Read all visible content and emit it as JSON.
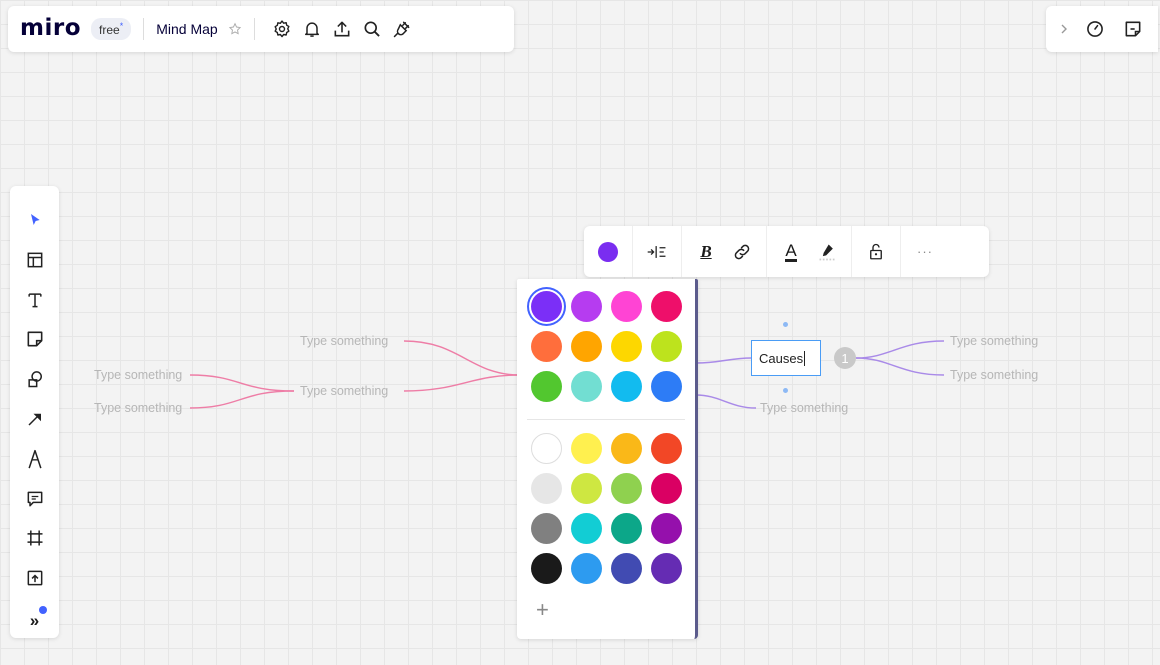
{
  "topbar": {
    "logo": "miro",
    "plan_badge": "free",
    "plan_badge_mark": "*",
    "board_name": "Mind Map",
    "icons": [
      "star-icon",
      "settings-icon",
      "bell-icon",
      "share-icon",
      "search-icon",
      "integrations-icon"
    ]
  },
  "topbar_right": {
    "icons": [
      "chevron-right-icon",
      "timer-icon",
      "sticky-export-icon"
    ]
  },
  "left_toolbar": {
    "tools": [
      "select-tool",
      "templates-tool",
      "text-tool",
      "sticky-note-tool",
      "shapes-tool",
      "connection-line-tool",
      "pen-tool",
      "comment-tool",
      "frame-tool",
      "upload-tool",
      "more-tools"
    ],
    "more_label": "»"
  },
  "mind_map": {
    "selected_node_text": "Causes",
    "collapse_label": "1",
    "nodes": [
      "Type something",
      "Type something",
      "Type something",
      "Type something",
      "Type something",
      "Type something",
      "Type something"
    ],
    "colors": {
      "left_branch": "#ee7da6",
      "right_branch": "#a98ae8",
      "selected_border": "#4a9cf5"
    }
  },
  "context_toolbar": {
    "node_color": "#7a2df0",
    "buttons": [
      "color-button",
      "layout-button",
      "bold-button",
      "link-button",
      "text-color-button",
      "highlight-button",
      "lock-button",
      "more-button"
    ],
    "bold_label": "B",
    "text_color_label": "A",
    "more_label": "···"
  },
  "color_palette": {
    "recent": [
      "#7b2ff7",
      "#b63cf0",
      "#ff44d4",
      "#ee0f6a",
      "#ff6e3c",
      "#ffa500",
      "#fdd700",
      "#bde31d",
      "#52c72f",
      "#72ded2",
      "#12bbef",
      "#2d7cf6"
    ],
    "standard": [
      "#ffffff",
      "#fff04f",
      "#fab818",
      "#f24726",
      "#e6e6e6",
      "#cee741",
      "#8fd14f",
      "#da0063",
      "#808080",
      "#12cdd4",
      "#0ca789",
      "#9510ac",
      "#1a1a1a",
      "#2d9bf0",
      "#414bb2",
      "#652cb3"
    ],
    "selected": "#7b2ff7",
    "add_label": "+"
  }
}
